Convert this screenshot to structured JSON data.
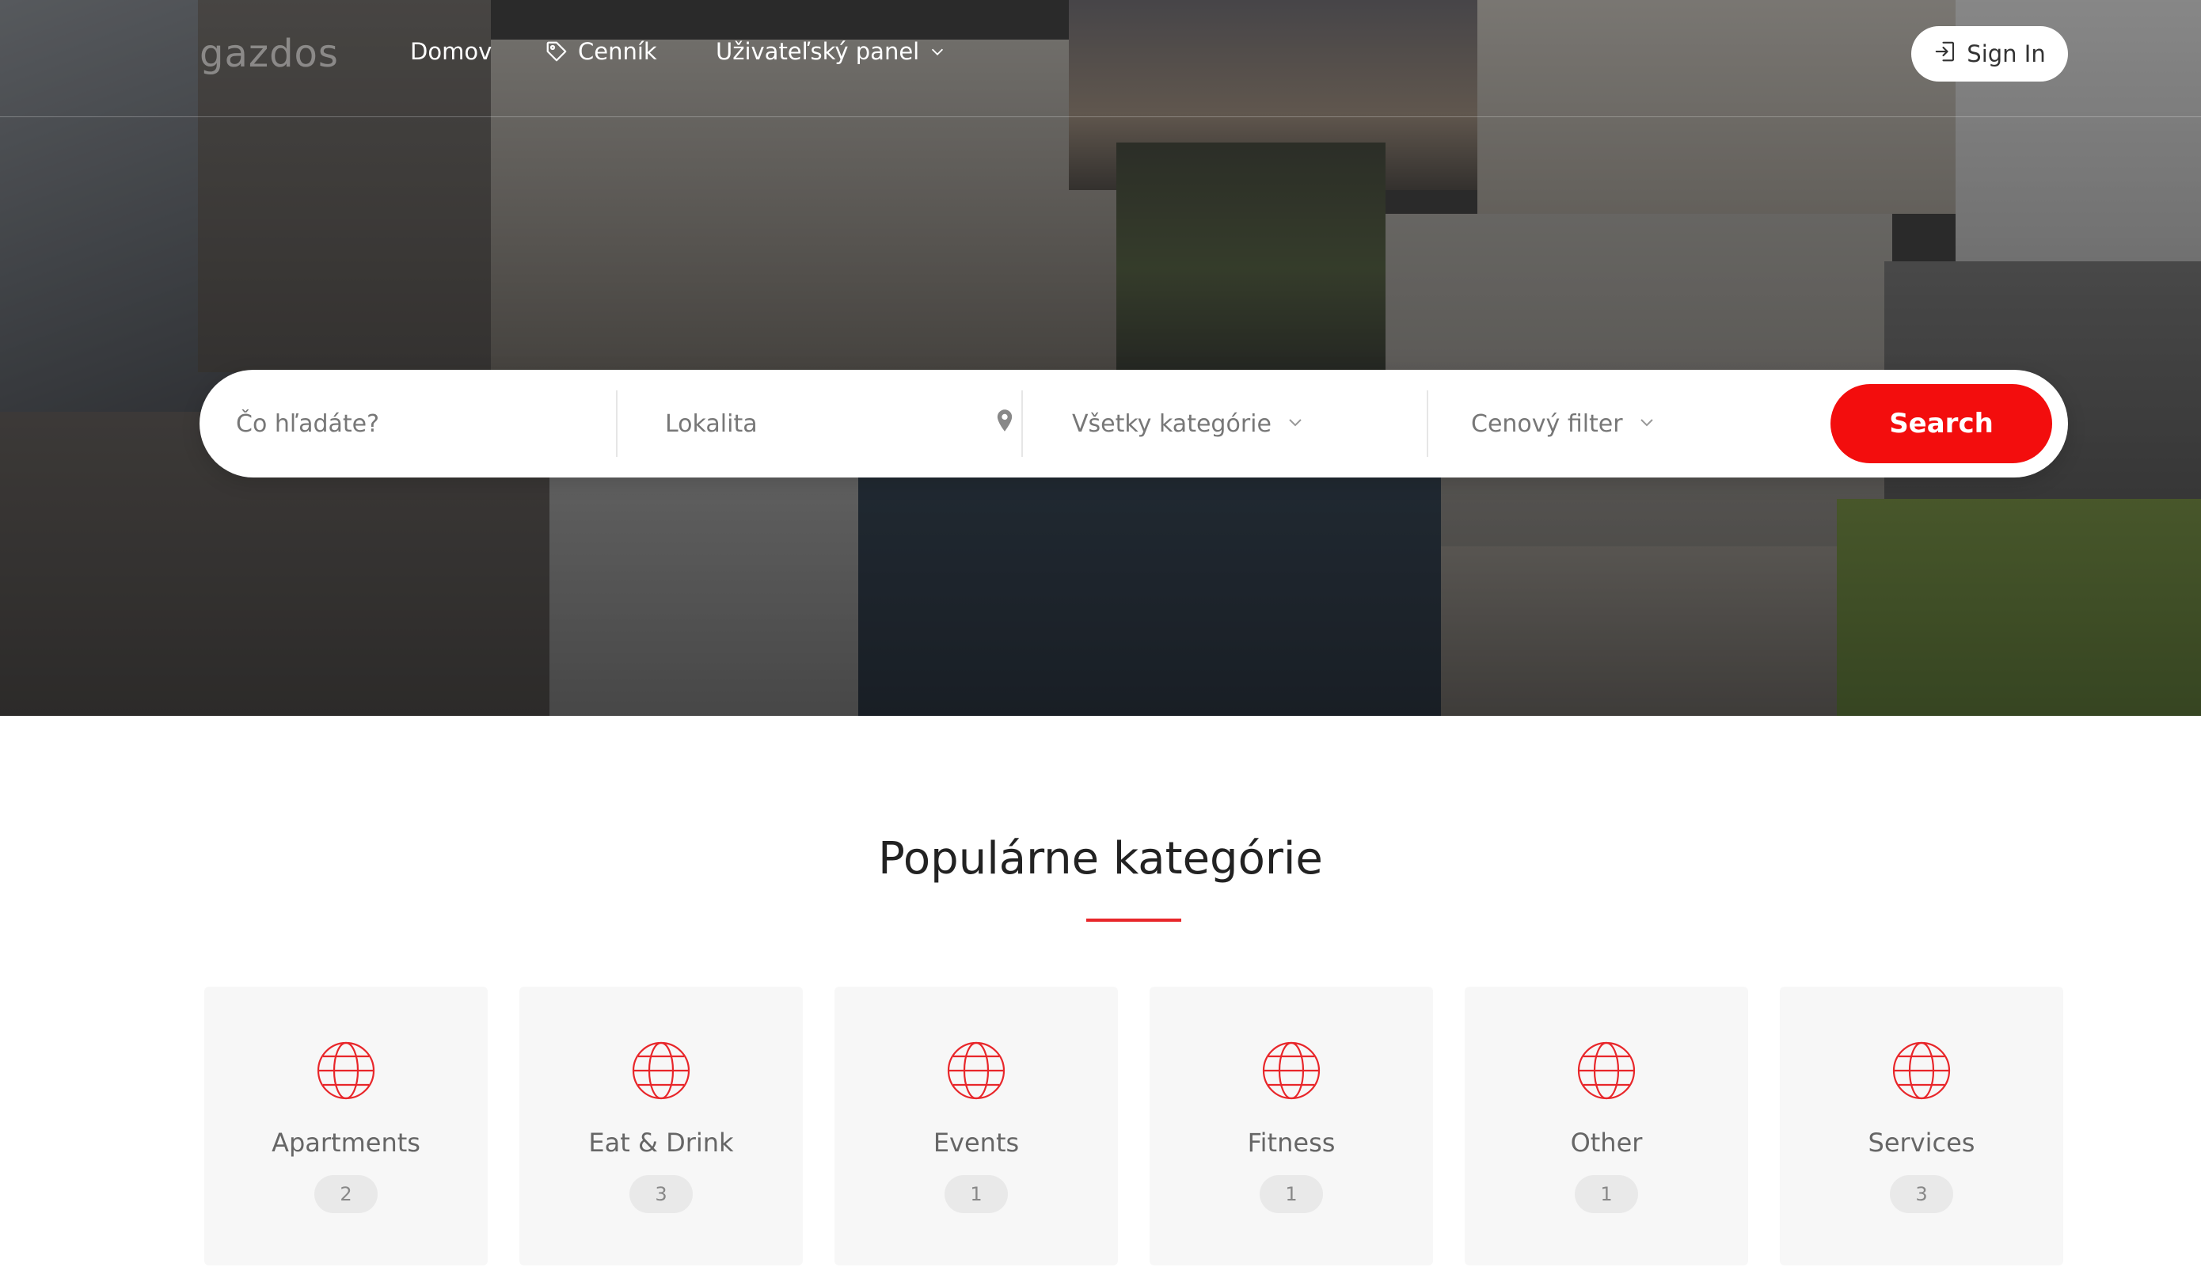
{
  "header": {
    "logo": "gazdos",
    "nav": [
      {
        "label": "Domov"
      },
      {
        "label": "Cenník",
        "icon": "tag-icon"
      },
      {
        "label": "Uživateľský panel",
        "icon": "chevron-down-icon"
      }
    ],
    "sign_in_label": "Sign In"
  },
  "search": {
    "keyword_placeholder": "Čo hľadáte?",
    "location_placeholder": "Lokalita",
    "category_label": "Všetky kategórie",
    "price_label": "Cenový filter",
    "button_label": "Search"
  },
  "popular": {
    "title": "Populárne kategórie",
    "categories": [
      {
        "label": "Apartments",
        "count": "2"
      },
      {
        "label": "Eat & Drink",
        "count": "3"
      },
      {
        "label": "Events",
        "count": "1"
      },
      {
        "label": "Fitness",
        "count": "1"
      },
      {
        "label": "Other",
        "count": "1"
      },
      {
        "label": "Services",
        "count": "3"
      }
    ]
  },
  "colors": {
    "accent": "#f30d0d",
    "icon": "#e8262a",
    "card_bg": "#f7f7f7"
  }
}
